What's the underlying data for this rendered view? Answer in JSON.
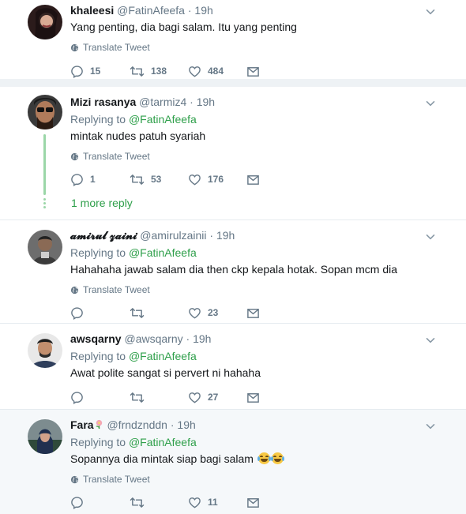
{
  "tweets": [
    {
      "name": "khaleesi",
      "handle": "@FatinAfeefa",
      "dot": "·",
      "time": "19h",
      "text": "Yang penting, dia bagi salam. Itu yang penting",
      "translate": "Translate Tweet",
      "replies": "15",
      "retweets": "138",
      "likes": "484"
    },
    {
      "name": "Mizi rasanya",
      "handle": "@tarmiz4",
      "dot": "·",
      "time": "19h",
      "replying_prefix": "Replying to",
      "replying_to": "@FatinAfeefa",
      "text": "mintak nudes patuh syariah",
      "translate": "Translate Tweet",
      "replies": "1",
      "retweets": "53",
      "likes": "176",
      "more_replies": "1 more reply"
    },
    {
      "name": "𝓪𝓶𝓲𝓻𝓾𝓵 𝔃𝓪𝓲𝓷𝓲",
      "handle": "@amirulzainii",
      "dot": "·",
      "time": "19h",
      "replying_prefix": "Replying to",
      "replying_to": "@FatinAfeefa",
      "text": "Hahahaha jawab salam dia then ckp kepala hotak. Sopan mcm dia",
      "translate": "Translate Tweet",
      "replies": "",
      "retweets": "",
      "likes": "23"
    },
    {
      "name": "awsqarny",
      "handle": "@awsqarny",
      "dot": "·",
      "time": "19h",
      "replying_prefix": "Replying to",
      "replying_to": "@FatinAfeefa",
      "text": "Awat polite sangat si pervert ni hahaha",
      "replies": "",
      "retweets": "",
      "likes": "27"
    },
    {
      "name": "Fara",
      "handle": "@frndznddn",
      "dot": "·",
      "time": "19h",
      "replying_prefix": "Replying to",
      "replying_to": "@FatinAfeefa",
      "text": "Sopannya dia mintak siap bagi salam",
      "translate": "Translate Tweet",
      "replies": "",
      "retweets": "",
      "likes": "11"
    }
  ],
  "colors": {
    "accent_green": "#2e9f4a",
    "muted": "#657786",
    "separator": "#e6ecf0",
    "highlight_bg": "#f5f8fa"
  },
  "icons": [
    "reply-icon",
    "retweet-icon",
    "like-icon",
    "message-icon",
    "globe-icon",
    "chevron-down-icon",
    "crying-laughing-emoji",
    "flower-emoji"
  ]
}
